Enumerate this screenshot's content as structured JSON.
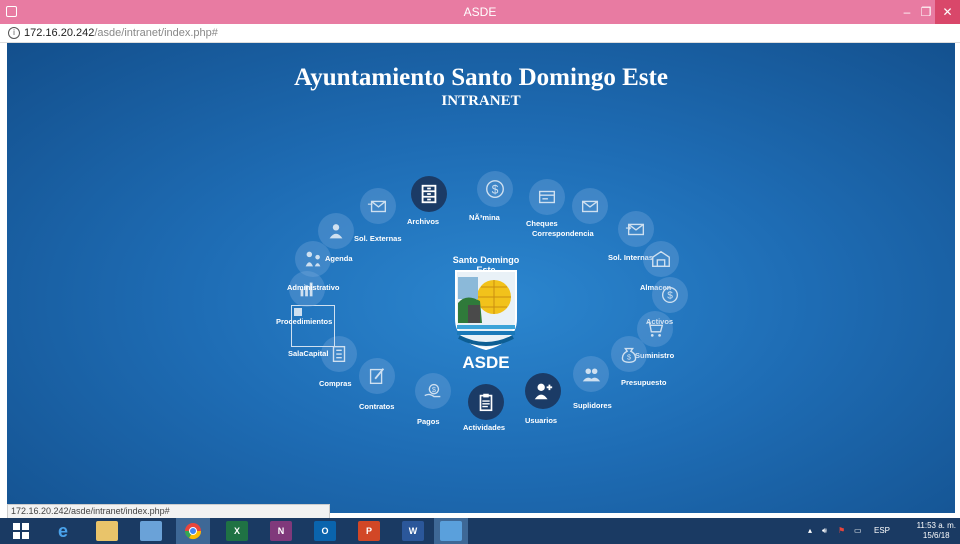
{
  "window": {
    "title": "ASDE",
    "minimize": "–",
    "maximize": "❐",
    "close": "✕"
  },
  "address": {
    "host": "172.16.20.242",
    "path": "/asde/intranet/index.php#",
    "info_glyph": "i"
  },
  "header": {
    "title": "Ayuntamiento Santo Domingo Este",
    "subtitle": "INTRANET"
  },
  "logo": {
    "top_text": "Santo Domingo Este",
    "bottom_text": "ASDE"
  },
  "menu": {
    "archivos": "Archivos",
    "nomina": "NÃ³mina",
    "cheques": "Cheques",
    "correspondencia": "Correspondencia",
    "sol_internas": "Sol. Internas",
    "almacen": "Almacen",
    "activos": "Activos",
    "suministro": "Suministro",
    "presupuesto": "Presupuesto",
    "suplidores": "Suplidores",
    "usuarios": "Usuarios",
    "actividades": "Actividades",
    "pagos": "Pagos",
    "contratos": "Contratos",
    "compras": "Compras",
    "salacapital": "SalaCapital",
    "procedimientos": "Procedimientos",
    "administrativo": "Administrativo",
    "agenda": "Agenda",
    "sol_externas": "Sol. Externas"
  },
  "statusbar": {
    "text": "172.16.20.242/asde/intranet/index.php#"
  },
  "taskbar": {
    "excel": "X",
    "onenote": "N",
    "outlook": "O",
    "powerpoint": "P",
    "word": "W",
    "lang": "ESP",
    "time": "11:53 a. m.",
    "date": "15/6/18"
  },
  "colors": {
    "titlebar": "#e87ba2",
    "background": "#1e6cb4",
    "taskbar": "#1a3a63",
    "active_circle": "#1b3b66"
  }
}
